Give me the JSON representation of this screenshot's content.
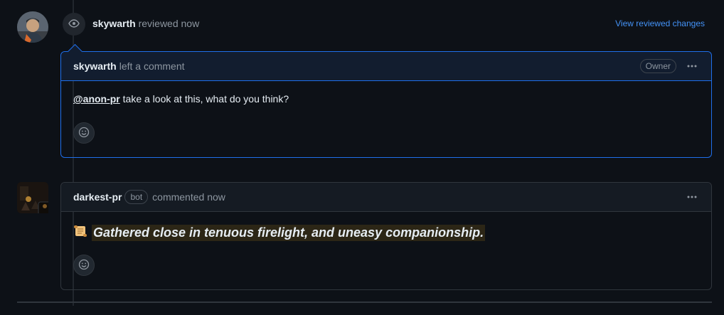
{
  "review": {
    "author": "skywarth",
    "action": "reviewed now",
    "link": "View reviewed changes"
  },
  "review_comment": {
    "author": "skywarth",
    "meta": "left a comment",
    "owner_label": "Owner",
    "mention": "@anon-pr",
    "text": " take a look at this, what do you think?"
  },
  "bot_comment": {
    "author": "darkest-pr",
    "bot_label": "bot",
    "meta": "commented now",
    "text": "Gathered close in tenuous firelight, and uneasy companionship."
  },
  "icons": {
    "review": "eye-icon",
    "more": "kebab-horizontal-icon",
    "reaction": "smiley-icon",
    "bot_emoji": "scroll-icon"
  },
  "colors": {
    "accent": "#1f6feb",
    "link": "#4493f8",
    "background": "#0d1117"
  }
}
